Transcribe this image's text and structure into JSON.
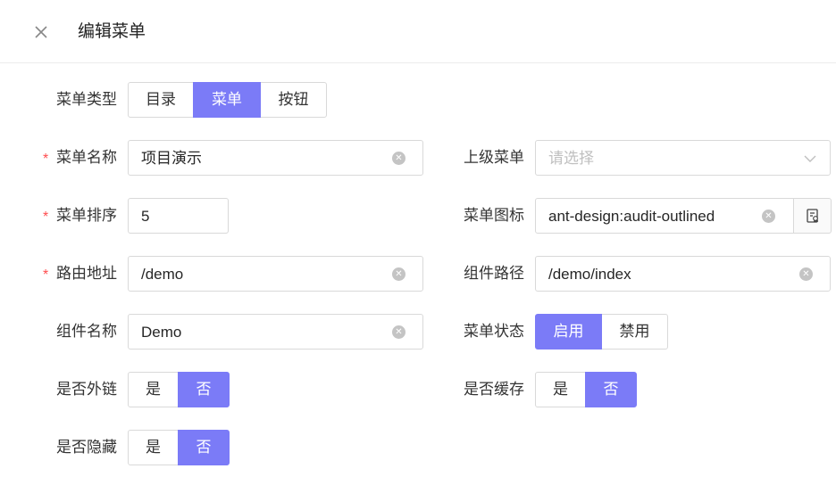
{
  "header": {
    "title": "编辑菜单",
    "close_icon": "close-icon"
  },
  "form": {
    "menu_type": {
      "label": "菜单类型",
      "options": [
        "目录",
        "菜单",
        "按钮"
      ],
      "selected": "菜单"
    },
    "menu_name": {
      "label": "菜单名称",
      "required": "*",
      "value": "项目演示"
    },
    "parent_menu": {
      "label": "上级菜单",
      "placeholder": "请选择"
    },
    "menu_order": {
      "label": "菜单排序",
      "required": "*",
      "value": "5"
    },
    "menu_icon": {
      "label": "菜单图标",
      "value": "ant-design:audit-outlined",
      "icon": "audit-icon"
    },
    "route_path": {
      "label": "路由地址",
      "required": "*",
      "value": "/demo"
    },
    "component_path": {
      "label": "组件路径",
      "value": "/demo/index"
    },
    "component_name": {
      "label": "组件名称",
      "value": "Demo"
    },
    "menu_status": {
      "label": "菜单状态",
      "options": [
        "启用",
        "禁用"
      ],
      "selected": "启用"
    },
    "is_external": {
      "label": "是否外链",
      "options": [
        "是",
        "否"
      ],
      "selected": "否"
    },
    "is_cached": {
      "label": "是否缓存",
      "options": [
        "是",
        "否"
      ],
      "selected": "否"
    },
    "is_hidden": {
      "label": "是否隐藏",
      "options": [
        "是",
        "否"
      ],
      "selected": "否"
    }
  },
  "colors": {
    "accent": "#7b7bf7",
    "required": "#ff4d4f",
    "border": "#d9d9d9"
  }
}
